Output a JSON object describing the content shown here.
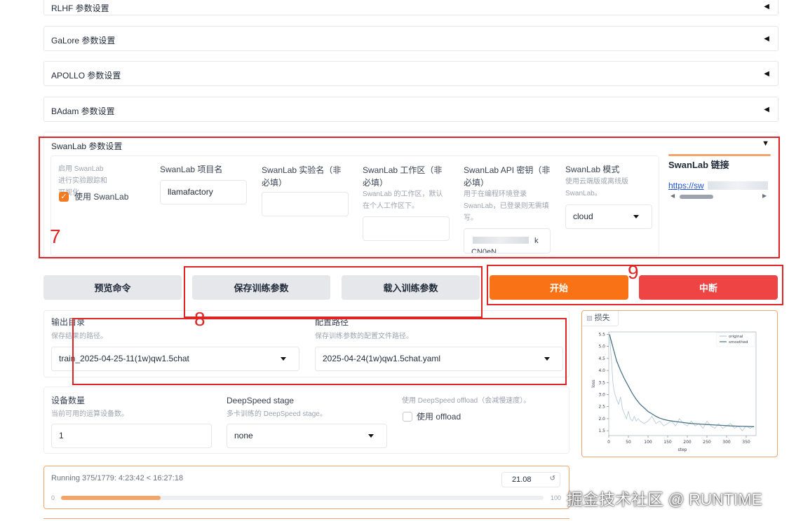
{
  "accordions": [
    {
      "title": "RLHF 参数设置"
    },
    {
      "title": "GaLore 参数设置"
    },
    {
      "title": "APOLLO 参数设置"
    },
    {
      "title": "BAdam 参数设置"
    }
  ],
  "swanlab": {
    "title": "SwanLab 参数设置",
    "use_hint": "启用 SwanLab 进行实验跟踪和可视化。",
    "use_label": "使用 SwanLab",
    "use_checked": true,
    "project_label": "SwanLab 项目名",
    "project_value": "llamafactory",
    "run_name_label": "SwanLab 实验名（非必填）",
    "workspace_label": "SwanLab 工作区（非必填）",
    "workspace_hint": "SwanLab 的工作区，默认在个人工作区下。",
    "api_key_label": "SwanLab API 密钥（非必填）",
    "api_key_hint": "用于在编程环境登录 SwanLab，已登录则无需填写。",
    "api_key_value_line1": "k",
    "api_key_value_line2": "CN0eN",
    "mode_label": "SwanLab 模式",
    "mode_hint": "使用云端版或离线版 SwanLab。",
    "mode_value": "cloud",
    "link_title": "SwanLab 链接",
    "link_text": "https://sw"
  },
  "buttons": {
    "preview": "预览命令",
    "save": "保存训练参数",
    "load": "载入训练参数",
    "start": "开始",
    "abort": "中断"
  },
  "output": {
    "dir_label": "输出目录",
    "dir_hint": "保存结果的路径。",
    "dir_value": "train_2025-04-25-11(1w)qw1.5chat",
    "config_label": "配置路径",
    "config_hint": "保存训练参数的配置文件路径。",
    "config_value": "2025-04-24(1w)qw1.5chat.yaml"
  },
  "devices": {
    "count_label": "设备数量",
    "count_hint": "当前可用的运算设备数。",
    "count_value": "1",
    "ds_label": "DeepSpeed stage",
    "ds_hint": "多卡训练的 DeepSpeed stage。",
    "ds_value": "none",
    "offload_hint": "使用 DeepSpeed offload（会减慢速度）。",
    "offload_label": "使用 offload"
  },
  "progress": {
    "status": "Running 375/1779: 4:23:42 < 16:27:18",
    "value": "21.08",
    "min": "0",
    "max": "100",
    "percent": 21.08
  },
  "loss_chart": {
    "tab_label": "损失",
    "legend_original": "original",
    "legend_smoothed": "smoothed",
    "xlabel": "step",
    "ylabel": "loss"
  },
  "chart_data": {
    "type": "line",
    "title": "",
    "xlabel": "step",
    "ylabel": "loss",
    "xlim": [
      0,
      375
    ],
    "ylim": [
      1.3,
      5.6
    ],
    "x_ticks": [
      "0",
      "50",
      "100",
      "150",
      "200",
      "250",
      "300",
      "350"
    ],
    "y_ticks": [
      "1.5",
      "2.0",
      "2.5",
      "3.0",
      "3.5",
      "4.0",
      "4.5",
      "5.0",
      "5.5"
    ],
    "legend_position": "top-right",
    "series": [
      {
        "name": "original",
        "color": "#b8ccd6",
        "x": [
          2,
          5,
          8,
          10,
          13,
          16,
          20,
          25,
          30,
          35,
          40,
          45,
          50,
          55,
          60,
          65,
          70,
          75,
          80,
          90,
          100,
          110,
          120,
          130,
          140,
          150,
          160,
          170,
          180,
          190,
          200,
          210,
          220,
          230,
          240,
          250,
          260,
          270,
          280,
          290,
          300,
          310,
          320,
          330,
          340,
          350,
          360,
          370
        ],
        "y": [
          5.5,
          4.8,
          4.2,
          3.6,
          3.2,
          3.0,
          2.8,
          2.6,
          2.9,
          2.4,
          2.2,
          2.0,
          2.3,
          2.0,
          1.9,
          2.1,
          1.9,
          2.0,
          1.9,
          1.8,
          1.9,
          2.1,
          1.8,
          1.9,
          1.7,
          1.8,
          1.9,
          1.7,
          2.0,
          1.8,
          1.7,
          1.9,
          1.7,
          1.8,
          1.6,
          1.9,
          1.7,
          1.6,
          1.8,
          1.6,
          1.7,
          1.8,
          1.6,
          1.7,
          1.5,
          1.7,
          1.6,
          1.7
        ]
      },
      {
        "name": "smoothed",
        "color": "#4b7388",
        "x": [
          2,
          5,
          10,
          15,
          20,
          30,
          40,
          50,
          60,
          70,
          80,
          90,
          100,
          110,
          120,
          130,
          140,
          150,
          170,
          190,
          210,
          230,
          250,
          270,
          290,
          310,
          330,
          350,
          370
        ],
        "y": [
          5.5,
          5.3,
          5.0,
          4.7,
          4.4,
          4.0,
          3.65,
          3.35,
          3.05,
          2.8,
          2.6,
          2.45,
          2.3,
          2.2,
          2.1,
          2.02,
          1.97,
          1.93,
          1.88,
          1.84,
          1.8,
          1.78,
          1.76,
          1.74,
          1.72,
          1.7,
          1.69,
          1.68,
          1.67
        ]
      }
    ]
  },
  "annotations": {
    "box7": "7",
    "box8": "8",
    "box9": "9"
  },
  "watermark": "掘金技术社区 @ RUNTIME"
}
